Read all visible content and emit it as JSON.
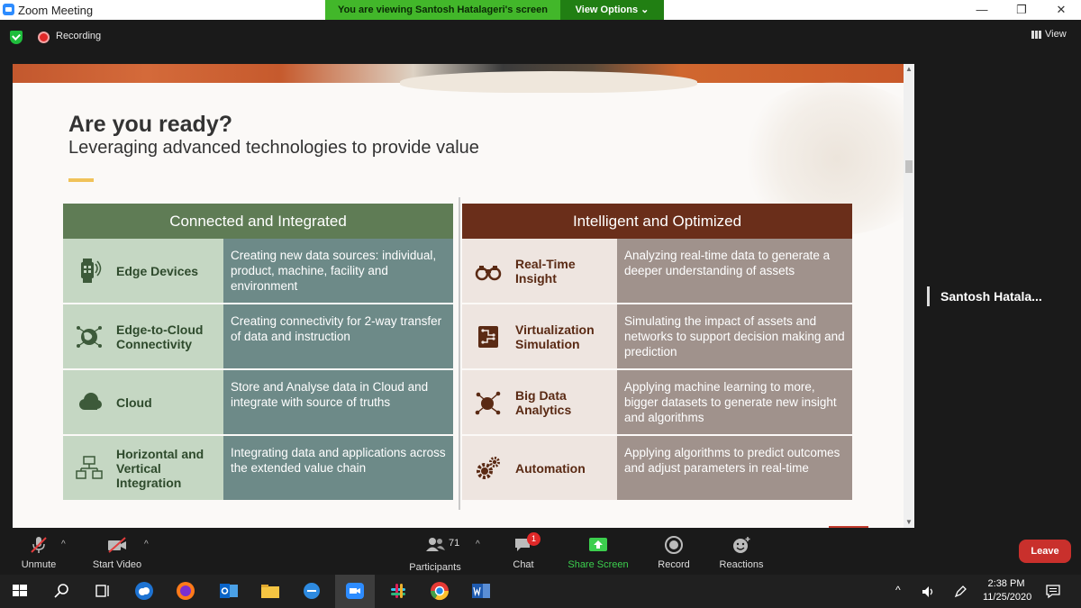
{
  "window": {
    "app_title": "Zoom Meeting",
    "share_banner": "You are viewing Santosh Hatalageri's screen",
    "view_options": "View Options ⌄",
    "minimize": "—",
    "restore": "❐",
    "close": "✕"
  },
  "topbar": {
    "recording_label": "Recording",
    "view_label": "View"
  },
  "slide": {
    "title": "Are you ready?",
    "subtitle": "Leveraging advanced technologies to provide value",
    "left_column": {
      "header": "Connected and Integrated",
      "rows": [
        {
          "name": "Edge Devices",
          "description": "Creating new data sources: individual, product, machine, facility and environment",
          "icon": "smartwatch-icon"
        },
        {
          "name": "Edge-to-Cloud Connectivity",
          "description": "Creating connectivity for 2-way transfer of data and instruction",
          "icon": "globe-network-icon"
        },
        {
          "name": "Cloud",
          "description": "Store and Analyse data in Cloud and integrate with source of truths",
          "icon": "cloud-icon"
        },
        {
          "name": "Horizontal and Vertical Integration",
          "description": "Integrating data and applications across the extended value chain",
          "icon": "integration-icon"
        }
      ]
    },
    "right_column": {
      "header": "Intelligent and Optimized",
      "rows": [
        {
          "name": "Real-Time Insight",
          "description": "Analyzing real-time data to generate a deeper understanding of assets",
          "icon": "binoculars-icon"
        },
        {
          "name": "Virtualization Simulation",
          "description": "Simulating the impact of assets and networks to support decision making and prediction",
          "icon": "circuit-chip-icon"
        },
        {
          "name": "Big Data Analytics",
          "description": "Applying machine learning to more, bigger datasets to generate new insight and algorithms",
          "icon": "data-analytics-icon"
        },
        {
          "name": "Automation",
          "description": "Applying algorithms to predict outcomes and adjust parameters in real-time",
          "icon": "gears-icon"
        }
      ]
    }
  },
  "participant": {
    "name": "Santosh  Hatala..."
  },
  "controls": {
    "unmute": "Unmute",
    "start_video": "Start Video",
    "participants": "Participants",
    "participants_count": "71",
    "chat": "Chat",
    "chat_badge": "1",
    "share_screen": "Share Screen",
    "record": "Record",
    "reactions": "Reactions",
    "leave": "Leave"
  },
  "taskbar": {
    "time": "2:38 PM",
    "date": "11/25/2020"
  },
  "colors": {
    "left_header": "#5f7c55",
    "right_header": "#6a2e1a",
    "banner_green": "#42b72a",
    "leave_red": "#c9302c"
  }
}
